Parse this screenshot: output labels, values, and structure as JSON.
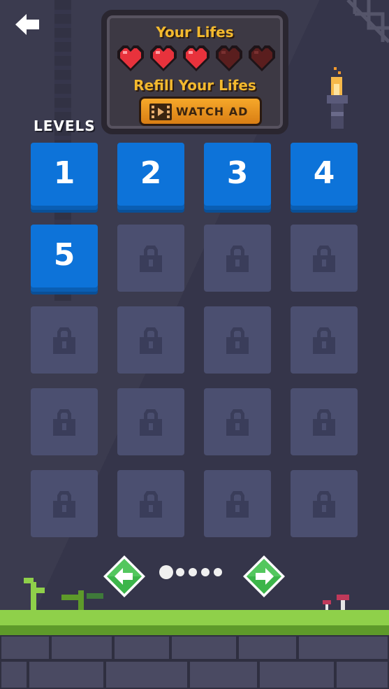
{
  "lives": {
    "title": "Your Lifes",
    "hearts_filled": 3,
    "hearts_total": 5,
    "refill_label": "Refill Your Lifes",
    "watch_ad_label": "WATCH AD"
  },
  "levels": {
    "heading": "LEVELS",
    "tiles": [
      {
        "label": "1",
        "locked": false
      },
      {
        "label": "2",
        "locked": false
      },
      {
        "label": "3",
        "locked": false
      },
      {
        "label": "4",
        "locked": false
      },
      {
        "label": "5",
        "locked": false
      },
      {
        "label": "",
        "locked": true
      },
      {
        "label": "",
        "locked": true
      },
      {
        "label": "",
        "locked": true
      },
      {
        "label": "",
        "locked": true
      },
      {
        "label": "",
        "locked": true
      },
      {
        "label": "",
        "locked": true
      },
      {
        "label": "",
        "locked": true
      },
      {
        "label": "",
        "locked": true
      },
      {
        "label": "",
        "locked": true
      },
      {
        "label": "",
        "locked": true
      },
      {
        "label": "",
        "locked": true
      },
      {
        "label": "",
        "locked": true
      },
      {
        "label": "",
        "locked": true
      },
      {
        "label": "",
        "locked": true
      },
      {
        "label": "",
        "locked": true
      }
    ]
  },
  "pagination": {
    "current_page": 1,
    "total_pages": 5
  },
  "icons": {
    "back": "back-arrow-icon",
    "heart": "heart-icon",
    "film": "film-icon",
    "lock": "lock-icon",
    "prev": "arrow-left-icon",
    "next": "arrow-right-icon"
  },
  "colors": {
    "background": "#3a3a4e",
    "tile_unlocked": "#0d73d9",
    "tile_locked": "#4b4f70",
    "heart_full": "#e8323c",
    "heart_empty": "#5a1e1e",
    "accent_gold": "#f3b92e",
    "nav_green": "#3cb54a",
    "grass": "#8fd04a"
  }
}
